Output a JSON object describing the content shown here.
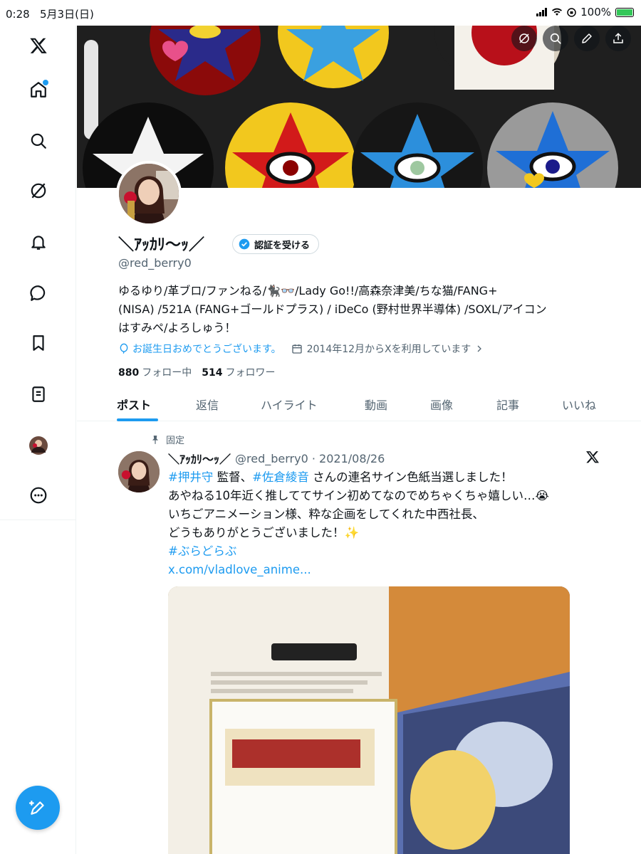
{
  "status_bar": {
    "time": "0:28",
    "date": "5月3日(日)",
    "battery": "100%"
  },
  "sidebar": {
    "items": [
      {
        "name": "x-logo"
      },
      {
        "name": "home",
        "has_dot": true
      },
      {
        "name": "search"
      },
      {
        "name": "grok"
      },
      {
        "name": "notifications"
      },
      {
        "name": "messages"
      },
      {
        "name": "bookmarks"
      },
      {
        "name": "lists"
      },
      {
        "name": "profile"
      },
      {
        "name": "more"
      }
    ]
  },
  "profile": {
    "name": "＼ｱｯｶﾘ〜ｯ／",
    "verify_label": "認証を受ける",
    "handle": "@red_berry0",
    "bio_lines": [
      "ゆるゆり/革ブロ/ファンねる/🐈‍⬛👓/Lady Go!!/高森奈津美/ちな猫/FANG+",
      "(NISA) /521A (FANG+ゴールドプラス) / iDeCo (野村世界半導体) /SOXL/アイコン",
      "はすみペ/よろしゅう！"
    ],
    "birthday": "お誕生日おめでとうございます。",
    "joined": "2014年12月からXを利用しています",
    "following_count": "880",
    "following_label": "フォロー中",
    "followers_count": "514",
    "followers_label": "フォロワー"
  },
  "tabs": [
    "ポスト",
    "返信",
    "ハイライト",
    "動画",
    "画像",
    "記事",
    "いいね"
  ],
  "pinned_tweet": {
    "pinned_label": "固定",
    "name": "＼ｱｯｶﾘ〜ｯ／",
    "handle_date": "@red_berry0 · 2021/08/26",
    "line1_tag1": "#押井守",
    "line1_mid": " 監督、",
    "line1_tag2": "#佐倉綾音",
    "line1_end": " さんの連名サイン色紙当選しました！",
    "line2": "あやねる10年近く推しててサイン初めてなのでめちゃくちゃ嬉しい…😭",
    "line3": "いちごアニメーション様、粋な企画をしてくれた中西社長、",
    "line4": "どうもありがとうございました！✨",
    "hashtag": " #ぶらどらぶ",
    "link": "x.com/vladlove_anime..."
  },
  "colors": {
    "accent": "#1d9bf0",
    "text": "#0f1419",
    "secondary": "#536471"
  }
}
